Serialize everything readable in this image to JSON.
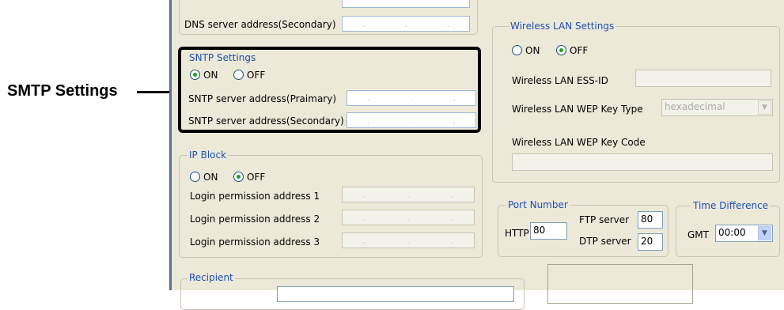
{
  "callout": {
    "label": "SMTP Settings"
  },
  "dns": {
    "secondary_label": "DNS server address(Secondary)"
  },
  "sntp": {
    "title": "SNTP Settings",
    "on_label": "ON",
    "off_label": "OFF",
    "selected": "ON",
    "primary_label": "SNTP server address(Praimary)",
    "secondary_label": "SNTP server address(Secondary)"
  },
  "ip_block": {
    "title": "IP Block",
    "on_label": "ON",
    "off_label": "OFF",
    "selected": "OFF",
    "login1_label": "Login permission address 1",
    "login2_label": "Login permission address 2",
    "login3_label": "Login permission address 3"
  },
  "recipient": {
    "title": "Recipient"
  },
  "wireless": {
    "title": "Wireless LAN Settings",
    "on_label": "ON",
    "off_label": "OFF",
    "selected": "OFF",
    "essid_label": "Wireless LAN ESS-ID",
    "essid_value": "",
    "wep_type_label": "Wireless LAN WEP Key Type",
    "wep_type_value": "hexadecimal",
    "wep_code_label": "Wireless LAN WEP Key Code",
    "wep_code_value": ""
  },
  "port": {
    "title": "Port Number",
    "http_label": "HTTP",
    "http_value": "80",
    "ftp_label": "FTP server",
    "ftp_value": "80",
    "dtp_label": "DTP server",
    "dtp_value": "20"
  },
  "time_diff": {
    "title": "Time Difference",
    "gmt_label": "GMT",
    "gmt_value": "00:00"
  },
  "ip_separator": ".",
  "colors": {
    "group_title": "#1f4fb5",
    "dialog_bg": "#ece9d8",
    "radio_dot": "#21a121"
  }
}
